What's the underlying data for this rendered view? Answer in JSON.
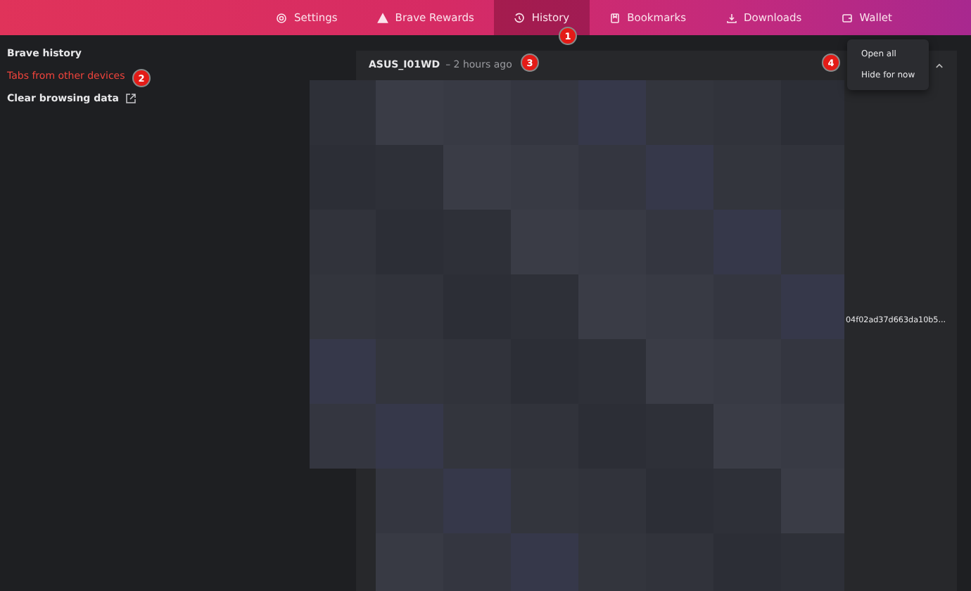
{
  "nav_tabs": [
    {
      "label": "Settings",
      "selected": false
    },
    {
      "label": "Brave Rewards",
      "selected": false
    },
    {
      "label": "History",
      "selected": true
    },
    {
      "label": "Bookmarks",
      "selected": false
    },
    {
      "label": "Downloads",
      "selected": false
    },
    {
      "label": "Wallet",
      "selected": false
    }
  ],
  "sidebar": {
    "items": [
      {
        "label": "Brave history",
        "selected": false,
        "external": false
      },
      {
        "label": "Tabs from other devices",
        "selected": true,
        "external": false
      },
      {
        "label": "Clear browsing data",
        "selected": false,
        "external": true
      }
    ]
  },
  "device_card": {
    "device": "ASUS_I01WD",
    "time": "– 2 hours ago",
    "expanded": true,
    "menu": [
      "Open all",
      "Hide for now"
    ],
    "visible_tab_text": "04f02ad37d663da10b5..."
  },
  "callouts": [
    "1",
    "2",
    "3",
    "4"
  ]
}
